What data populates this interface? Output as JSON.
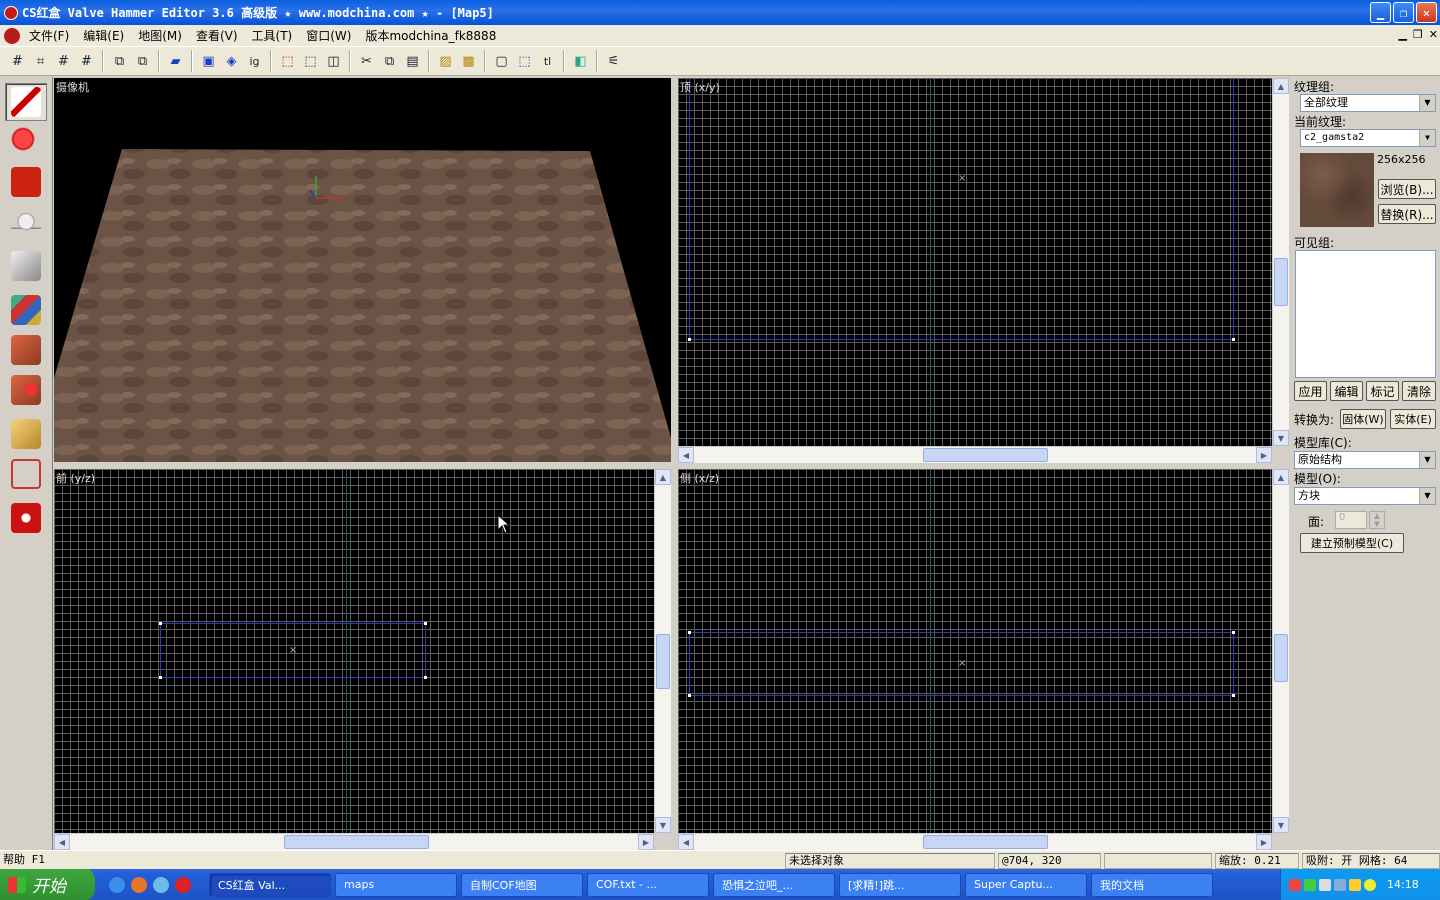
{
  "window": {
    "title": "CS红盒 Valve Hammer Editor 3.6 高级版 ★ www.modchina.com ★ - [Map5]"
  },
  "menu": {
    "items": [
      "文件(F)",
      "编辑(E)",
      "地图(M)",
      "查看(V)",
      "工具(T)",
      "窗口(W)",
      "版本modchina_fk8888"
    ]
  },
  "viewports": {
    "camera": "摄像机",
    "top": "顶 (x/y)",
    "front": "前 (y/z)",
    "side": "侧 (x/z)"
  },
  "texture_panel": {
    "group_label": "纹理组:",
    "group_value": "全部纹理",
    "current_label": "当前纹理:",
    "current_value": "c2_gamsta2",
    "size": "256x256",
    "browse": "浏览(B)...",
    "replace": "替换(R)...",
    "visgroup_label": "可见组:",
    "apply": "应用",
    "edit": "编辑",
    "mark": "标记",
    "purge": "清除",
    "convert_label": "转换为:",
    "world": "固体(W)",
    "entity": "实体(E)",
    "library_label": "模型库(C):",
    "library_value": "原始结构",
    "model_label": "模型(O):",
    "model_value": "方块",
    "faces_label": "面:",
    "faces_value": "0",
    "create_prefab": "建立预制模型(C)"
  },
  "status": {
    "help": "帮助 F1",
    "selection": "未选择对象",
    "coords": "@704, 320",
    "zoom": "缩放: 0.21",
    "snap": "吸附: 开 网格: 64"
  },
  "taskbar": {
    "start": "开始",
    "tasks": [
      "CS红盒 Val...",
      "maps",
      "自制COF地图",
      "COF.txt - ...",
      "恐惧之泣吧_...",
      "[求精!]跳...",
      "Super Captu...",
      "我的文档"
    ],
    "clock": "14:18"
  }
}
